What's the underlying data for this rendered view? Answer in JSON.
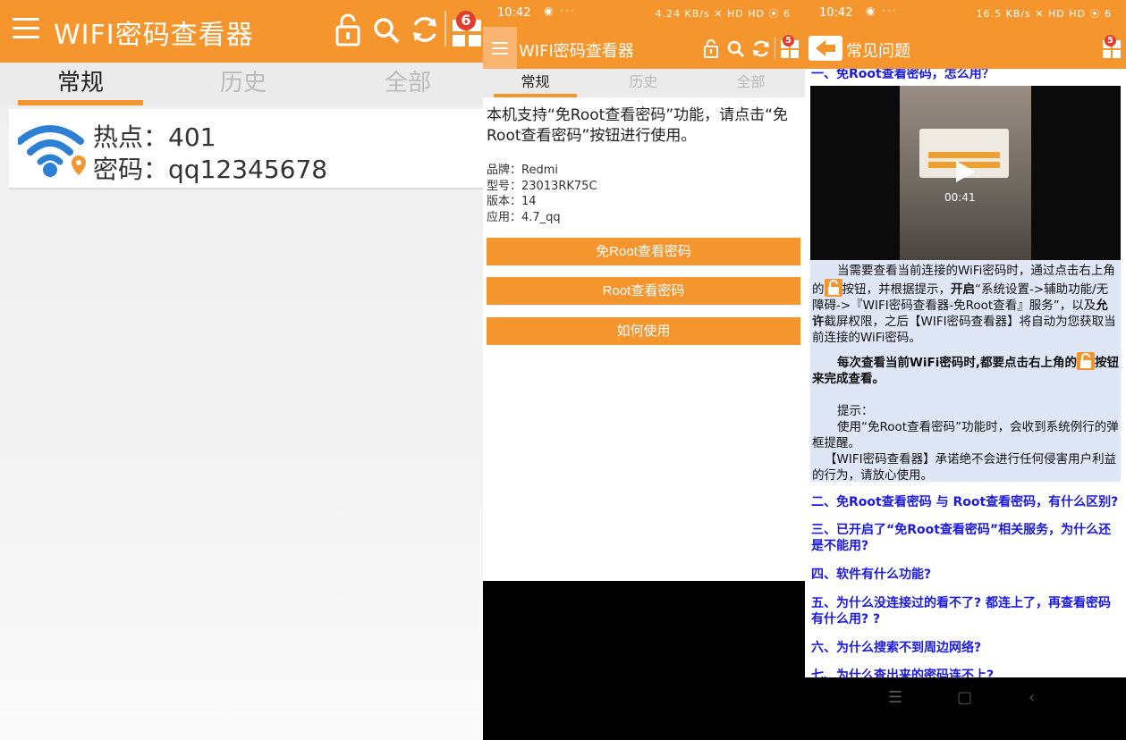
{
  "panel1": {
    "title": "WIFI密码查看器",
    "badge": "6",
    "tabs": [
      "常规",
      "历史",
      "全部"
    ],
    "hotspot_label": "热点：",
    "hotspot_value": "401",
    "password_label": "密码：",
    "password_value": "qq12345678"
  },
  "panel2": {
    "time": "10:42",
    "status_right": "4.24 KB/s ✕ HD HD ⦿ 6",
    "title": "WIFI密码查看器",
    "badge": "5",
    "tabs": [
      "常规",
      "历史",
      "全部"
    ],
    "intro": "本机支持“免Root查看密码”功能，请点击“免Root查看密码”按钮进行使用。",
    "info": {
      "brand": "品牌：Redmi",
      "model": "型号：23013RK75C",
      "version": "版本：14",
      "app": "应用：4.7_qq"
    },
    "buttons": [
      "免Root查看密码",
      "Root查看密码",
      "如何使用"
    ]
  },
  "panel3": {
    "time": "10:42",
    "status_right": "16.5 KB/s ✕ HD HD ⦿ 6",
    "title": "常见问题",
    "badge": "5",
    "q1": "一、免Root查看密码，怎么用？",
    "video_time": "00:41",
    "answer": {
      "p1a": "当需要查看当前连接的WiFi密码时，通过点击右上角的",
      "p1b": "按钮，并根据提示，",
      "p1c": "开启",
      "p1d": "“系统设置->辅助功能/无障碍->『WIFI密码查看器-免Root查看』服务”，以及",
      "p1e": "允许",
      "p1f": "截屏权限，之后【WIFI密码查看器】将自动为您获取当前连接的WiFi密码。",
      "p2a": "每次查看当前WiFi密码时,都要点击右上角的",
      "p2b": "按钮来完成查看。",
      "tip_title": "提示：",
      "tip1": "使用“免Root查看密码”功能时，会收到系统例行的弹框提醒。",
      "tip2": "【WIFI密码查看器】承诺绝不会进行任何侵害用户利益的行为，请放心使用。"
    },
    "questions": [
      "二、免Root查看密码 与 Root查看密码，有什么区别?",
      "三、已开启了“免Root查看密码”相关服务，为什么还是不能用?",
      "四、软件有什么功能?",
      "五、为什么没连接过的看不了? 都连上了，再查看密码有什么用? ?",
      "六、为什么搜索不到周边网络?",
      "七、为什么查出来的密码连不上?"
    ]
  }
}
